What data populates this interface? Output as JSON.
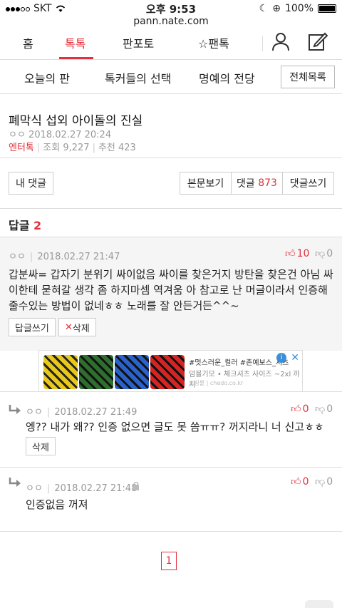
{
  "status_bar": {
    "carrier": "SKT",
    "time": "오후 9:53",
    "battery": "100%"
  },
  "url": "pann.nate.com",
  "top_nav": {
    "tabs": [
      "홈",
      "톡톡",
      "판포토",
      "☆팬톡"
    ],
    "active": "톡톡"
  },
  "sub_nav": {
    "items": [
      "오늘의 판",
      "톡커들의 선택",
      "명예의 전당"
    ],
    "all_label": "전체목록"
  },
  "article": {
    "title": "폐막식 섭외 아이돌의 진실",
    "author": "ㅇㅇ",
    "date": "2018.02.27 20:24",
    "category": "엔터톡",
    "views": "조회 9,227",
    "recommend": "추천 423"
  },
  "actions": {
    "my_comments": "내 댓글",
    "view_post": "본문보기",
    "comments_label": "댓글",
    "comments_count": "873",
    "write_comment": "댓글쓰기"
  },
  "replies": {
    "label": "답글",
    "count": "2"
  },
  "main_comment": {
    "author": "ㅇㅇ",
    "date": "2018.02.27 21:47",
    "up": "10",
    "down": "0",
    "text": "갑분싸= 갑자기 분위기 싸이없음 싸이를 찾은거지 방탄을 찾은건 아님 싸이한테 묻혀갈 생각 좀 하지마셈 역겨움 아 참고로 난 머글이라서 인증해줄수있는 방법이 없네ㅎㅎ 노래를 잘 안든거든^^~",
    "reply_btn": "답글쓰기",
    "delete_btn": "삭제"
  },
  "ad": {
    "line1": "#멋스러운_컬러 #존예보스_셔츠",
    "line2": "덤블기모 • 체크셔츠 사이즈 ~2xl 까지",
    "line3": "쇼핑몰  | chedo.co.kr"
  },
  "sub_replies": [
    {
      "author": "ㅇㅇ",
      "date": "2018.02.27 21:49",
      "up": "0",
      "down": "0",
      "text": "엥?? 내가 왜?? 인증 없으면 글도 못 씀ㅠㅠ? 꺼지라니 너 신고ㅎㅎ",
      "delete_btn": "삭제"
    },
    {
      "author": "ㅇㅇ",
      "date": "2018.02.27 21:48",
      "up": "0",
      "down": "0",
      "text": "인증없음 꺼져"
    }
  ],
  "pagination": {
    "current": "1"
  },
  "colors": {
    "accent": "#e4303c"
  }
}
